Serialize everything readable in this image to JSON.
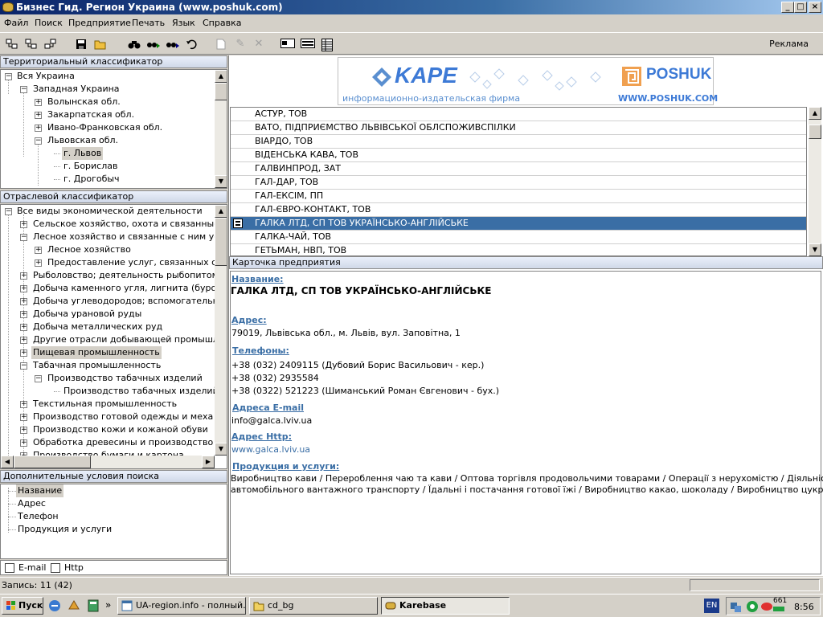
{
  "window": {
    "title": "Бизнес Гид. Регион Украина (www.poshuk.com)"
  },
  "menu": [
    "Файл",
    "Поиск",
    "Предприятие",
    "Печать",
    "Язык",
    "Справка"
  ],
  "toolbar": {
    "reklama": "Реклама"
  },
  "territorial": {
    "header": "Территориальный классификатор",
    "nodes": [
      "Вся Украина",
      "Западная Украина",
      "Волынская обл.",
      "Закарпатская обл.",
      "Ивано-Франковская обл.",
      "Львовская обл.",
      "г. Львов",
      "г. Борислав",
      "г. Дрогобыч"
    ]
  },
  "industry": {
    "header": "Отраслевой классификатор",
    "nodes": [
      "Все виды экономической деятельности",
      "Сельское хозяйство, охота и связанные с ним",
      "Лесное хозяйство и связанные с ним услуги",
      "Лесное хозяйство",
      "Предоставление услуг, связанных с лесо",
      "Рыболовство; деятельность рыбопитомник",
      "Добыча каменного угля, лигнита (бурого угля",
      "Добыча углеводородов; вспомогательные с",
      "Добыча урановой руды",
      "Добыча металлических руд",
      "Другие отрасли добывающей промышленно",
      "Пищевая промышленность",
      "Табачная промышленность",
      "Производство табачных изделий",
      "Производство табачных изделий",
      "Текстильная промышленность",
      "Производство готовой одежды и меха",
      "Производство кожи и кожаной обуви",
      "Обработка древесины и производство издел",
      "Производство бумаги и картона"
    ]
  },
  "extra": {
    "header": "Дополнительные условия поиска",
    "items": [
      "Название",
      "Адрес",
      "Телефон",
      "Продукция и услуги"
    ],
    "email_label": "E-mail",
    "http_label": "Http"
  },
  "banner": {
    "kape": "KAPE",
    "subtitle": "информационно-издательская фирма",
    "poshuk": "POSHUK",
    "url": "WWW.POSHUK.COM"
  },
  "companies": [
    "АСТУР, ТОВ",
    "ВАТО, ПІДПРИЄМСТВО ЛЬВІВСЬКОЇ ОБЛСПОЖИВСПІЛКИ",
    "ВІАРДО, ТОВ",
    "ВІДЕНСЬКА КАВА, ТОВ",
    "ГАЛВИНПРОД, ЗАТ",
    "ГАЛ-ДАР, ТОВ",
    "ГАЛ-ЕКСІМ, ПП",
    "ГАЛ-ЄВРО-КОНТАКТ, ТОВ",
    "ГАЛКА ЛТД, СП ТОВ УКРАЇНСЬКО-АНГЛІЙСЬКЕ",
    "ГАЛКА-ЧАЙ, ТОВ",
    "ГЕТЬМАН, НВП, ТОВ"
  ],
  "card": {
    "header": "Карточка предприятия",
    "name_label": "Название:",
    "name_value": "ГАЛКА ЛТД, СП ТОВ УКРАЇНСЬКО-АНГЛІЙСЬКЕ",
    "address_label": "Адрес:",
    "address_value": "79019, Львівська обл., м. Львів, вул. Заповітна, 1",
    "phones_label": "Телефоны:",
    "phones": [
      "+38 (032) 2409115 (Дубовий Борис Васильович - кер.)",
      "+38 (032) 2935584",
      "+38 (0322) 521223 (Шиманський Роман Євгенович - бух.)"
    ],
    "email_label": "Адреса E-mail",
    "email_value": "info@galca.lviv.ua",
    "http_label": "Адрес Http:",
    "http_value": "www.galca.lviv.ua",
    "products_label": "Продукция и услуги:",
    "products_line1": "Виробництво кави / Перероблення чаю та кави / Оптова торгівля продовольчими товарами / Операції з нерухомістю / Діяльність",
    "products_line2": "автомобільного вантажного транспорту / Їдальні і постачання готової їжі / Виробництво какао, шоколаду / Виробництво цукру"
  },
  "status": {
    "records": "Запись: 11 (42)"
  },
  "taskbar": {
    "start": "Пуск",
    "tasks": [
      "UA-region.info - полный...",
      "cd_bg",
      "Karebase"
    ],
    "lang": "EN",
    "tray_num": "661",
    "clock": "8:56"
  },
  "colors": {
    "selection": "#3a6ea5",
    "titlebar": "#0a246a",
    "link": "#3a6ea5"
  }
}
